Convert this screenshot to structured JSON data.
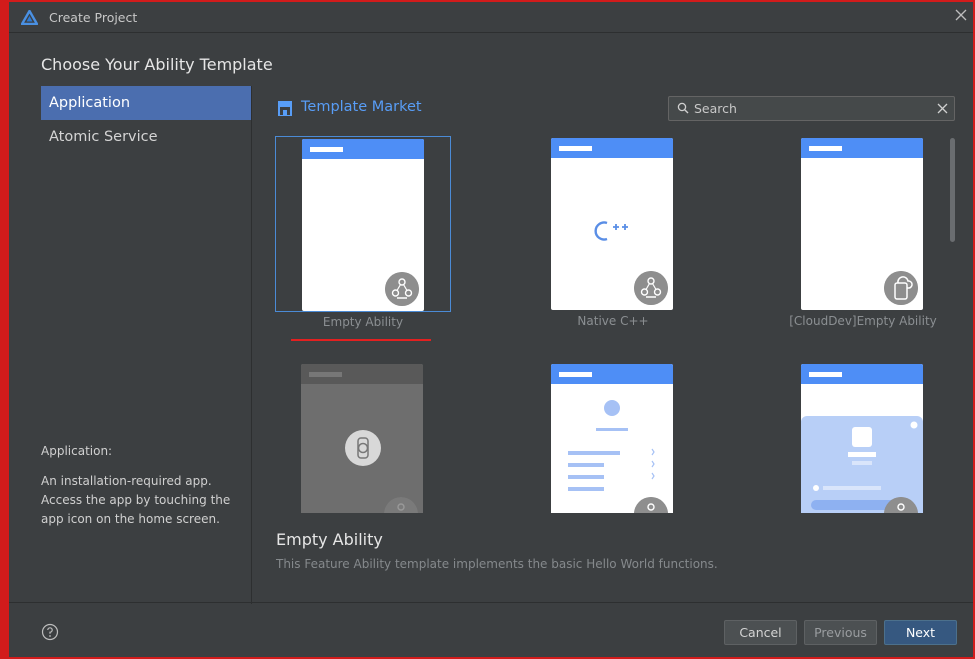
{
  "window": {
    "title": "Create Project"
  },
  "heading": "Choose Your Ability Template",
  "sidebar": {
    "items": [
      {
        "label": "Application",
        "active": true
      },
      {
        "label": "Atomic Service",
        "active": false
      }
    ],
    "desc_title": "Application:",
    "desc": "An installation-required app. Access the app by touching the app icon on the home screen."
  },
  "market": {
    "title": "Template Market",
    "icon": "store-icon"
  },
  "search": {
    "placeholder": "Search",
    "value": ""
  },
  "templates": [
    {
      "label": "Empty Ability",
      "badge_icon": "ability-node-icon",
      "selected": true
    },
    {
      "label": "Native C++",
      "badge_icon": "ability-node-icon",
      "center_text": "C++",
      "selected": false
    },
    {
      "label": "[CloudDev]Empty Ability",
      "badge_icon": "cloud-phone-icon",
      "selected": false
    },
    {
      "label": "",
      "badge_icon": "watch-icon",
      "selected": false
    },
    {
      "label": "",
      "badge_icon": "ability-node-icon",
      "selected": false
    },
    {
      "label": "",
      "badge_icon": "ability-node-icon",
      "selected": false
    }
  ],
  "description": {
    "title": "Empty Ability",
    "text": "This Feature Ability template implements the basic Hello World functions."
  },
  "footer": {
    "cancel_label": "Cancel",
    "previous_label": "Previous",
    "next_label": "Next"
  },
  "colors": {
    "accent": "#4b6eaf",
    "link_blue": "#589df6",
    "card_bar": "#4e8ef6",
    "selection_underline": "#e32020"
  }
}
